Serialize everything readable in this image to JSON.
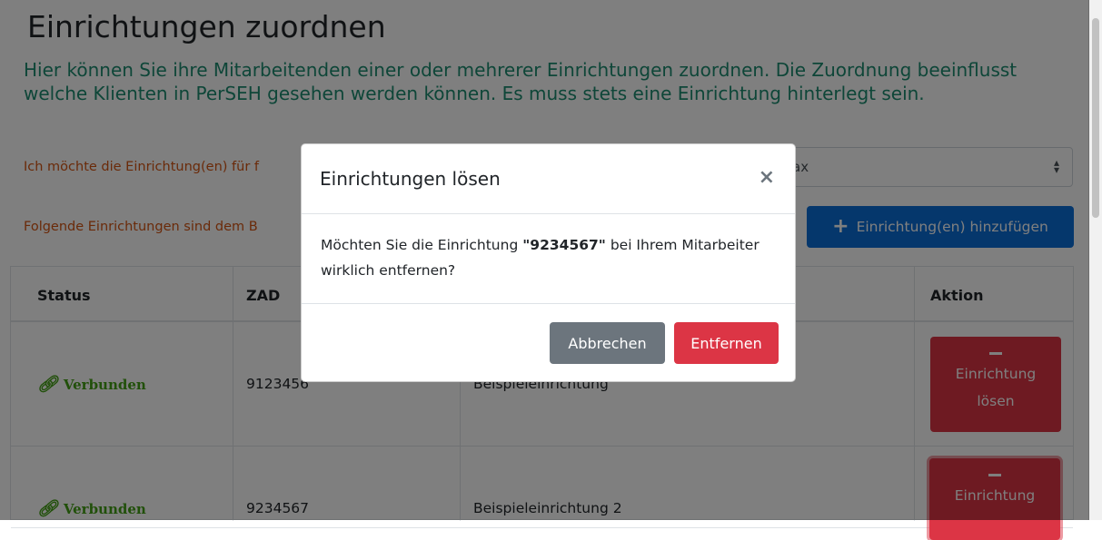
{
  "page": {
    "title": "Einrichtungen zuordnen",
    "lead": "Hier können Sie ihre Mitarbeitenden einer oder mehrerer Einrichtungen zuordnen. Die Zuordnung beeinflusst welche Klienten in PerSEH gesehen werden können. Es muss stets eine Einrichtung hinterlegt sein.",
    "question_label": "Ich möchte die Einrichtung(en) für f",
    "employee_select_value": "ax",
    "assigned_label": "Folgende Einrichtungen sind dem B",
    "add_button_label": "Einrichtung(en) hinzufügen"
  },
  "table": {
    "headers": {
      "status": "Status",
      "zad": "ZAD",
      "aktion": "Aktion"
    },
    "rows": [
      {
        "status": "Verbunden",
        "zad": "9123456",
        "name": "Beispieleinrichtung",
        "action_line1": "Einrichtung",
        "action_line2": "lösen"
      },
      {
        "status": "Verbunden",
        "zad": "9234567",
        "name": "Beispieleinrichtung 2",
        "action_line1": "Einrichtung"
      }
    ]
  },
  "modal": {
    "title": "Einrichtungen lösen",
    "close_symbol": "×",
    "body_prefix": "Möchten Sie die Einrichtung ",
    "body_highlight": "\"9234567\"",
    "body_suffix": " bei Ihrem Mitarbeiter wirklich entfernen?",
    "cancel_label": "Abbrechen",
    "remove_label": "Entfernen"
  },
  "colors": {
    "primary": "#0b6ed9",
    "danger": "#dc3545",
    "secondary": "#6c757d",
    "success_text": "#43a014",
    "lead_text": "#1c8c71",
    "warning_text": "#d55512"
  }
}
